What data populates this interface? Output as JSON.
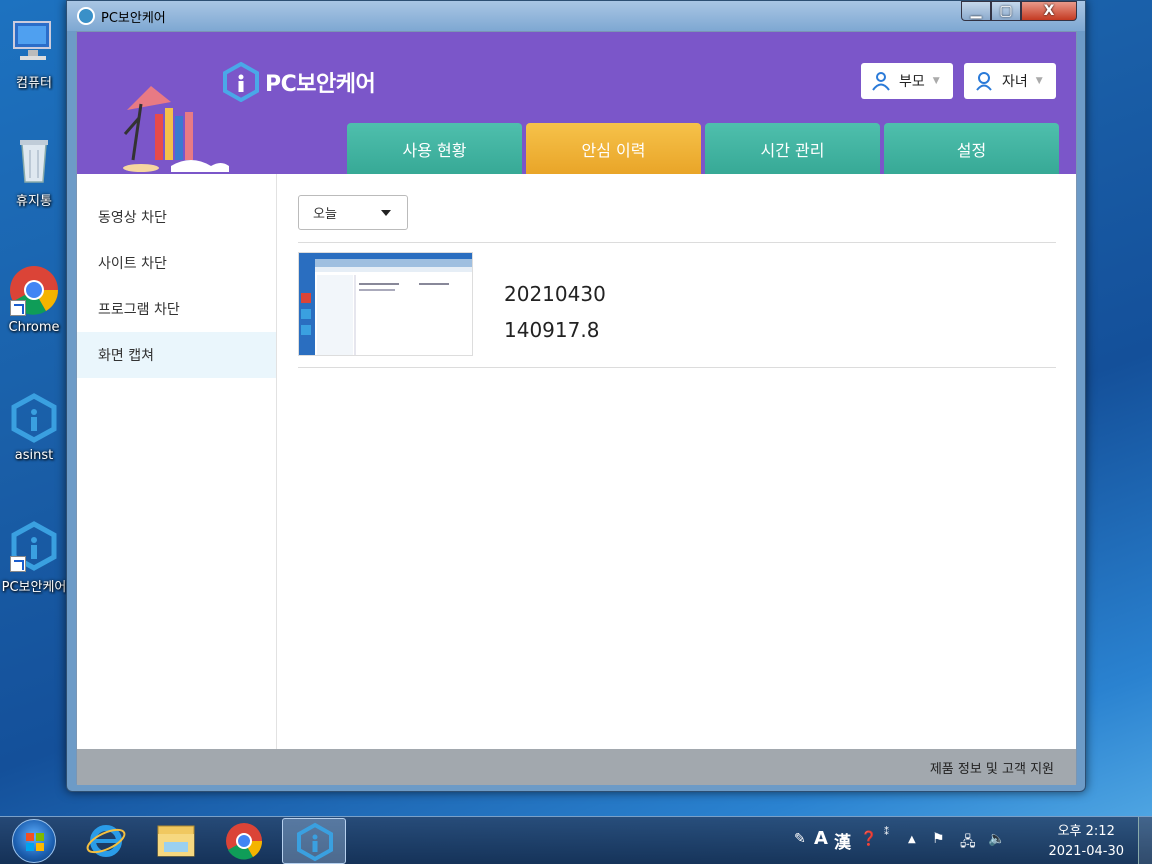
{
  "desktop": {
    "icons": [
      {
        "label": "컴퓨터",
        "icon": "computer-icon"
      },
      {
        "label": "휴지통",
        "icon": "recycle-bin-icon"
      },
      {
        "label": "Chrome",
        "icon": "chrome-icon"
      },
      {
        "label": "asinst",
        "icon": "pc-care-icon"
      },
      {
        "label": "PC보안케어",
        "icon": "pc-care-icon"
      }
    ]
  },
  "window": {
    "title": "PC보안케어",
    "controls": {
      "minimize": "▁",
      "maximize": "▢",
      "close": "X"
    }
  },
  "app": {
    "logo_text": "PC보안케어",
    "users": [
      {
        "label": "부모",
        "icon": "person-icon"
      },
      {
        "label": "자녀",
        "icon": "child-icon"
      }
    ],
    "tabs": [
      {
        "label": "사용 현황",
        "active": false
      },
      {
        "label": "안심 이력",
        "active": true
      },
      {
        "label": "시간 관리",
        "active": false
      },
      {
        "label": "설정",
        "active": false
      }
    ],
    "sidebar": [
      {
        "label": "동영상 차단",
        "active": false
      },
      {
        "label": "사이트 차단",
        "active": false
      },
      {
        "label": "프로그램 차단",
        "active": false
      },
      {
        "label": "화면 캡쳐",
        "active": true
      }
    ],
    "filter": {
      "selected": "오늘"
    },
    "captures": [
      {
        "date": "20210430",
        "time": "140917.8"
      }
    ],
    "footer_link": "제품 정보 및 고객 지원",
    "colors": {
      "header": "#7b56c9",
      "tab": "#3fb39f",
      "tab_active": "#f0b33a"
    }
  },
  "taskbar": {
    "apps": [
      "start-orb",
      "internet-explorer-icon",
      "file-explorer-icon",
      "chrome-icon",
      "pc-care-icon"
    ],
    "ime": {
      "mode": "A",
      "hanja": "漢"
    },
    "clock": {
      "time": "오후 2:12",
      "date": "2021-04-30"
    }
  }
}
